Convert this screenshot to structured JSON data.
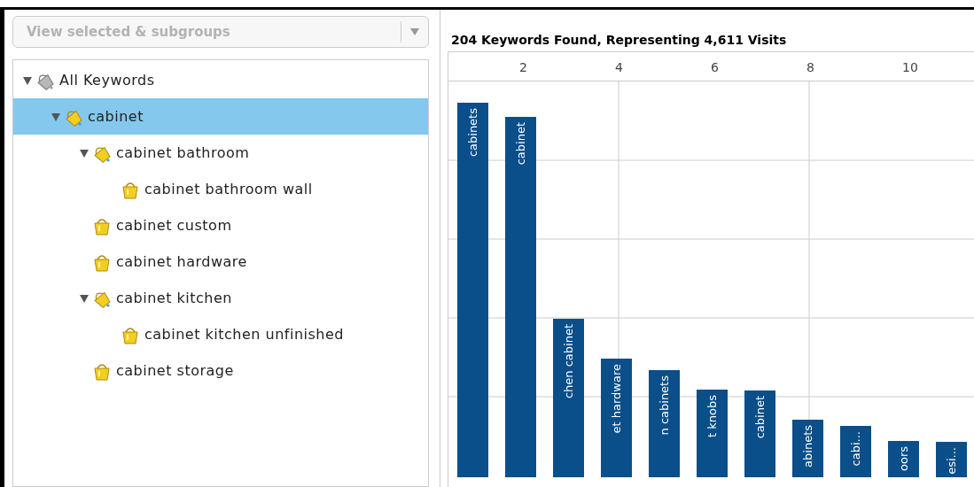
{
  "filter_dropdown": {
    "value": "View selected & subgroups"
  },
  "tree": [
    {
      "label": "All Keywords",
      "kind": "root",
      "expanded": true,
      "selected": false,
      "children": [
        {
          "label": "cabinet",
          "kind": "group",
          "expanded": true,
          "selected": true,
          "children": [
            {
              "label": "cabinet bathroom",
              "kind": "group",
              "expanded": true,
              "selected": false,
              "children": [
                {
                  "label": "cabinet bathroom wall",
                  "kind": "leaf",
                  "selected": false
                }
              ]
            },
            {
              "label": "cabinet custom",
              "kind": "leaf",
              "selected": false
            },
            {
              "label": "cabinet hardware",
              "kind": "leaf",
              "selected": false
            },
            {
              "label": "cabinet kitchen",
              "kind": "group",
              "expanded": true,
              "selected": false,
              "children": [
                {
                  "label": "cabinet kitchen unfinished",
                  "kind": "leaf",
                  "selected": false
                }
              ]
            },
            {
              "label": "cabinet storage",
              "kind": "leaf",
              "selected": false
            }
          ]
        }
      ]
    }
  ],
  "chart": {
    "title": "204 Keywords Found, Representing 4,611 Visits",
    "ticks": [
      "2",
      "4",
      "6",
      "8",
      "10"
    ],
    "bars": [
      {
        "label": "cabinets"
      },
      {
        "label": "cabinet"
      },
      {
        "label": "chen cabinet"
      },
      {
        "label": "et hardware"
      },
      {
        "label": "n cabinets"
      },
      {
        "label": "t knobs"
      },
      {
        "label": "cabinet"
      },
      {
        "label": "abinets"
      },
      {
        "label": "cabi..."
      },
      {
        "label": "oors"
      },
      {
        "label": "esi..."
      }
    ]
  }
}
